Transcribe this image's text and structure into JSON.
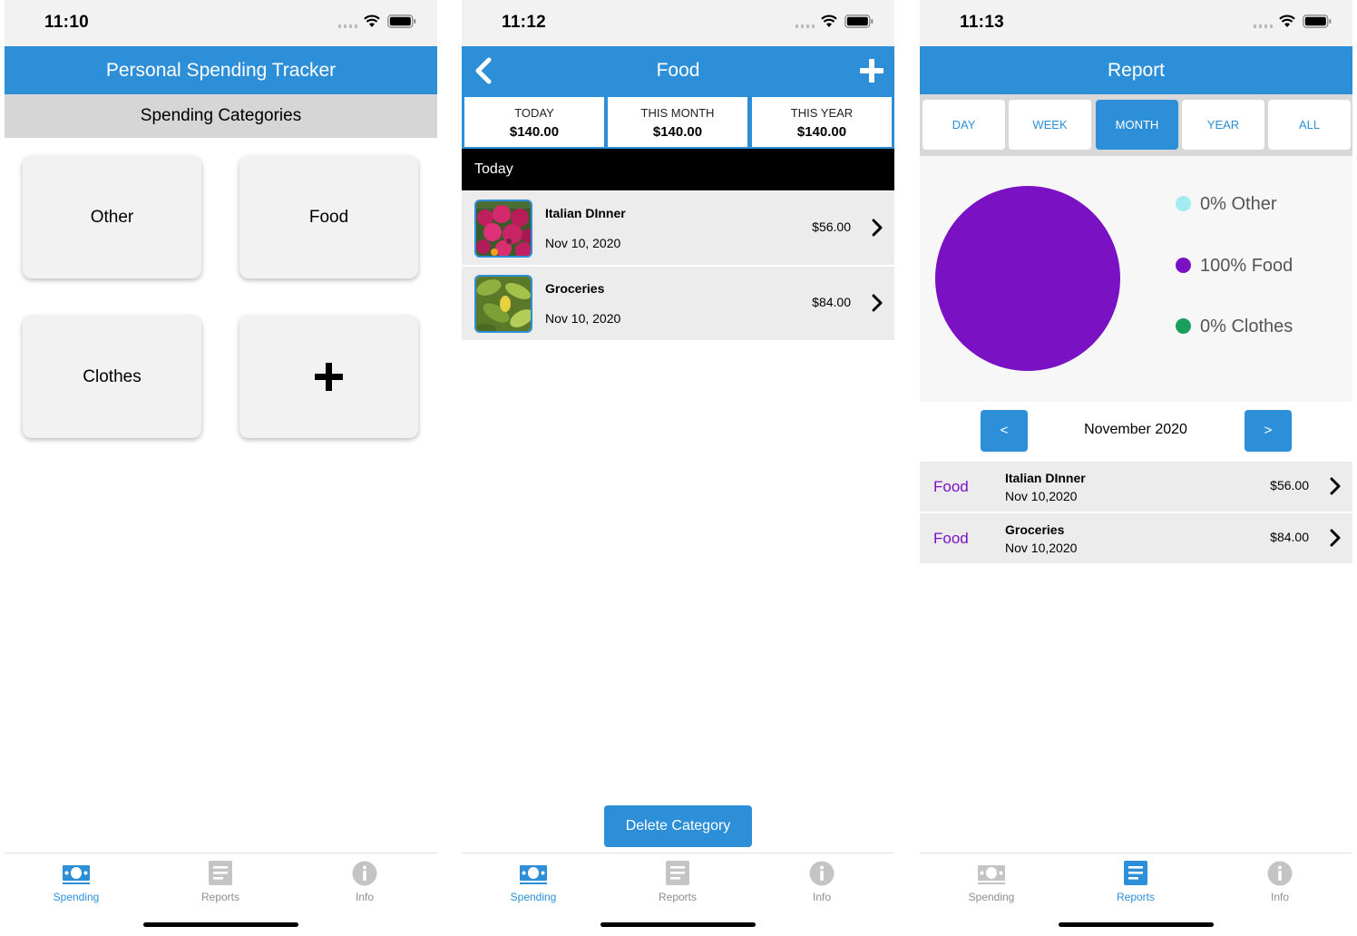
{
  "screens": [
    {
      "time": "11:10",
      "title": "Personal Spending Tracker",
      "section_header": "Spending Categories",
      "categories": [
        {
          "label": "Other"
        },
        {
          "label": "Food"
        },
        {
          "label": "Clothes"
        },
        {
          "label": "",
          "icon": "plus-icon"
        }
      ],
      "tabs": [
        {
          "label": "Spending",
          "icon": "money-icon",
          "active": true
        },
        {
          "label": "Reports",
          "icon": "reports-icon",
          "active": false
        },
        {
          "label": "Info",
          "icon": "info-icon",
          "active": false
        }
      ]
    },
    {
      "time": "11:12",
      "title": "Food",
      "stats": [
        {
          "label": "TODAY",
          "value": "$140.00"
        },
        {
          "label": "THIS MONTH",
          "value": "$140.00"
        },
        {
          "label": "THIS YEAR",
          "value": "$140.00"
        }
      ],
      "group_header": "Today",
      "transactions": [
        {
          "name": "Italian DInner",
          "date": "Nov 10, 2020",
          "amount": "$56.00",
          "image": "flowers-photo"
        },
        {
          "name": "Groceries",
          "date": "Nov 10, 2020",
          "amount": "$84.00",
          "image": "leaves-photo"
        }
      ],
      "delete_label": "Delete Category",
      "tabs": [
        {
          "label": "Spending",
          "icon": "money-icon",
          "active": true
        },
        {
          "label": "Reports",
          "icon": "reports-icon",
          "active": false
        },
        {
          "label": "Info",
          "icon": "info-icon",
          "active": false
        }
      ]
    },
    {
      "time": "11:13",
      "title": "Report",
      "periods": [
        "DAY",
        "WEEK",
        "MONTH",
        "YEAR",
        "ALL"
      ],
      "active_period": "MONTH",
      "chart_data": {
        "type": "pie",
        "categories": [
          "Other",
          "Food",
          "Clothes"
        ],
        "values": [
          0,
          100,
          0
        ],
        "legend": [
          "0% Other",
          "100% Food",
          "0% Clothes"
        ],
        "colors": [
          "#a3eaf2",
          "#7a12c4",
          "#1a9e5c"
        ],
        "legend_position": "right"
      },
      "prev_label": "<",
      "next_label": ">",
      "month": "November 2020",
      "rows": [
        {
          "category": "Food",
          "name": "Italian DInner",
          "date": "Nov 10,2020",
          "amount": "$56.00"
        },
        {
          "category": "Food",
          "name": "Groceries",
          "date": "Nov 10,2020",
          "amount": "$84.00"
        }
      ],
      "tabs": [
        {
          "label": "Spending",
          "icon": "money-icon",
          "active": false
        },
        {
          "label": "Reports",
          "icon": "reports-icon",
          "active": true
        },
        {
          "label": "Info",
          "icon": "info-icon",
          "active": false
        }
      ]
    }
  ],
  "colors": {
    "primary": "#2d8fd8",
    "inactive_tab": "#8e8e8e",
    "food_purple": "#7a12c4"
  }
}
